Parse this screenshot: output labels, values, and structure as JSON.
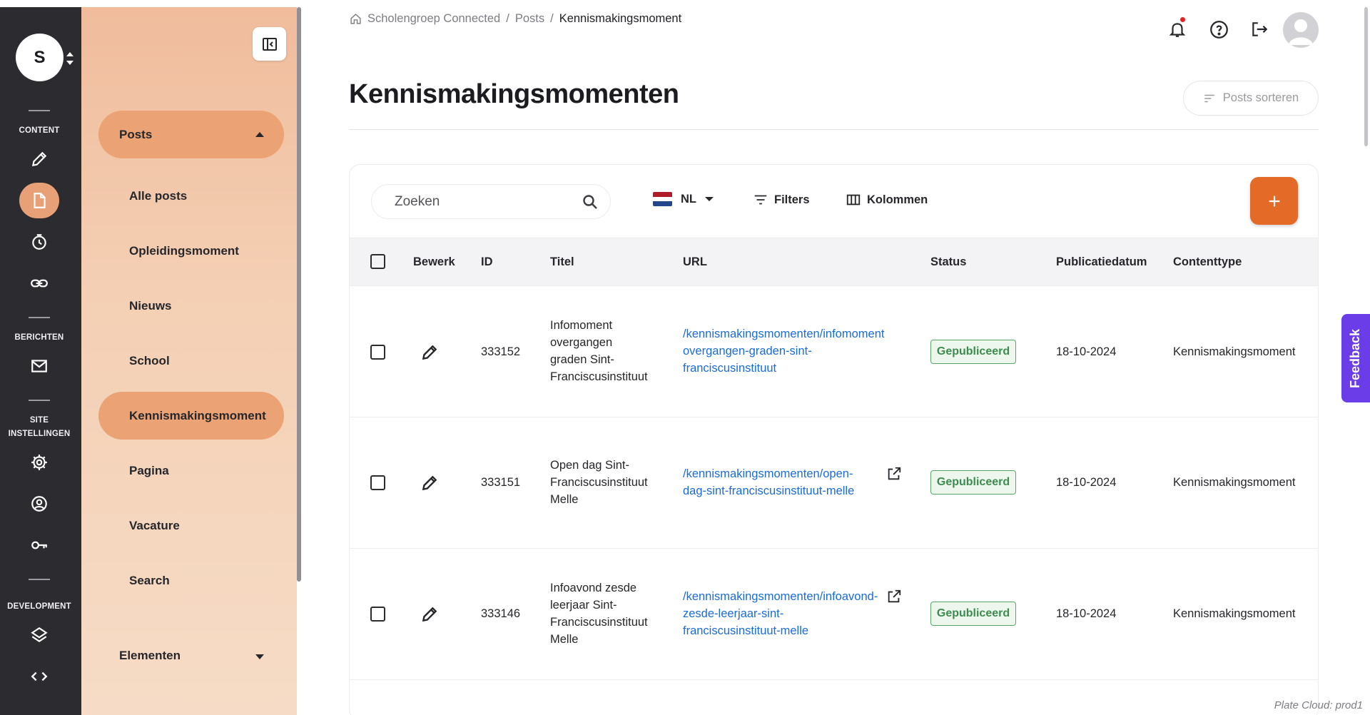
{
  "rail": {
    "site_initial": "S",
    "sections": {
      "content": "CONTENT",
      "berichten": "BERICHTEN",
      "site_line1": "SITE",
      "site_line2": "INSTELLINGEN",
      "development": "DEVELOPMENT"
    }
  },
  "sidebar": {
    "group_posts": "Posts",
    "items": [
      "Alle posts",
      "Opleidingsmoment",
      "Nieuws",
      "School",
      "Kennismakingsmoment",
      "Pagina",
      "Vacature",
      "Search"
    ],
    "active_item": "Kennismakingsmoment",
    "group_elementen": "Elementen"
  },
  "breadcrumb": {
    "home": "Scholengroep Connected",
    "sep": "/",
    "level2": "Posts",
    "current": "Kennismakingsmoment"
  },
  "page": {
    "title": "Kennismakingsmomenten",
    "sort_label": "Posts sorteren"
  },
  "toolbar": {
    "search_placeholder": "Zoeken",
    "language": "NL",
    "filters": "Filters",
    "columns": "Kolommen"
  },
  "table": {
    "headers": {
      "edit": "Bewerk",
      "id": "ID",
      "title": "Titel",
      "url": "URL",
      "status": "Status",
      "date": "Publicatiedatum",
      "type": "Contenttype"
    },
    "rows": [
      {
        "id": "333152",
        "title_lines": [
          "Infomoment",
          "overgangen",
          "graden Sint-",
          "Franciscusinstituut"
        ],
        "url_lines": [
          "/kennismakingsmomenten/infomoment",
          "overgangen-graden-sint-",
          "franciscusinstituut"
        ],
        "status": "Gepubliceerd",
        "date": "18-10-2024",
        "type": "Kennismakingsmoment"
      },
      {
        "id": "333151",
        "title_lines": [
          "Open dag Sint-",
          "Franciscusinstituut",
          "Melle"
        ],
        "url_lines": [
          "/kennismakingsmomenten/open-",
          "dag-sint-franciscusinstituut-melle"
        ],
        "status": "Gepubliceerd",
        "date": "18-10-2024",
        "type": "Kennismakingsmoment"
      },
      {
        "id": "333146",
        "title_lines": [
          "Infoavond zesde",
          "leerjaar Sint-",
          "Franciscusinstituut",
          "Melle"
        ],
        "url_lines": [
          "/kennismakingsmomenten/infoavond-",
          "zesde-leerjaar-sint-",
          "franciscusinstituut-melle"
        ],
        "status": "Gepubliceerd",
        "date": "18-10-2024",
        "type": "Kennismakingsmoment"
      }
    ]
  },
  "feedback_label": "Feedback",
  "footer_note": "Plate Cloud: prod1",
  "colors": {
    "rail_bg": "#2b2b30",
    "accent": "#eba375",
    "add_button": "#e46a27",
    "link": "#1a6cd6",
    "status_green": "#3d8c4e",
    "feedback": "#6a3de8"
  },
  "icons": {
    "rail": [
      "pencil-icon",
      "document-icon",
      "clock-icon",
      "link-icon",
      "mail-icon",
      "gear-icon",
      "user-circle-icon",
      "key-icon",
      "layers-icon",
      "code-icon"
    ],
    "header": [
      "bell-icon",
      "help-icon",
      "logout-icon",
      "user-avatar"
    ]
  }
}
